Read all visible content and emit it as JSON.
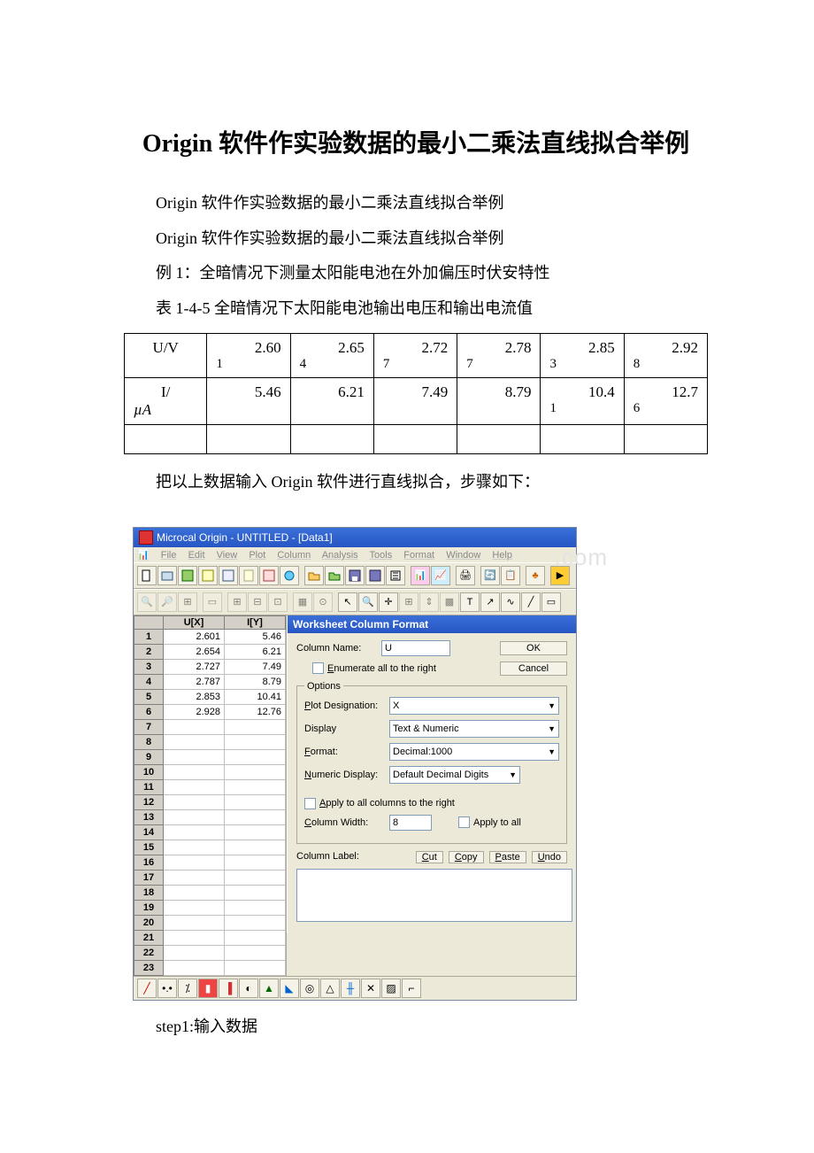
{
  "doc": {
    "title": "Origin 软件作实验数据的最小二乘法直线拟合举例",
    "p1": "Origin 软件作实验数据的最小二乘法直线拟合举例",
    "p2": "Origin 软件作实验数据的最小二乘法直线拟合举例",
    "p3": "例 1：全暗情况下测量太阳能电池在外加偏压时伏安特性",
    "p4": "表 1-4-5 全暗情况下太阳能电池输出电压和输出电流值",
    "p5": "把以上数据输入 Origin 软件进行直线拟合，步骤如下：",
    "p6": "step1:输入数据"
  },
  "table": {
    "row1_head": "U/V",
    "row2_head_html": "I/",
    "row2_head_unit": "µA",
    "cols": [
      {
        "u_top": "2.60",
        "u_bot": "1",
        "i": "5.46",
        "i_bot": ""
      },
      {
        "u_top": "2.65",
        "u_bot": "4",
        "i": "6.21",
        "i_bot": ""
      },
      {
        "u_top": "2.72",
        "u_bot": "7",
        "i": "7.49",
        "i_bot": ""
      },
      {
        "u_top": "2.78",
        "u_bot": "7",
        "i": "8.79",
        "i_bot": ""
      },
      {
        "u_top": "2.85",
        "u_bot": "3",
        "i": "10.4",
        "i_bot": "1"
      },
      {
        "u_top": "2.92",
        "u_bot": "8",
        "i": "12.7",
        "i_bot": "6"
      }
    ]
  },
  "origin": {
    "title": "Microcal Origin - UNTITLED - [Data1]",
    "menu": [
      "File",
      "Edit",
      "View",
      "Plot",
      "Column",
      "Analysis",
      "Tools",
      "Format",
      "Window",
      "Help"
    ],
    "sheet": {
      "headers": [
        "U[X]",
        "I[Y]"
      ],
      "rows": [
        {
          "n": "1",
          "x": "2.601",
          "y": "5.46"
        },
        {
          "n": "2",
          "x": "2.654",
          "y": "6.21"
        },
        {
          "n": "3",
          "x": "2.727",
          "y": "7.49"
        },
        {
          "n": "4",
          "x": "2.787",
          "y": "8.79"
        },
        {
          "n": "5",
          "x": "2.853",
          "y": "10.41"
        },
        {
          "n": "6",
          "x": "2.928",
          "y": "12.76"
        },
        {
          "n": "7",
          "x": "",
          "y": ""
        },
        {
          "n": "8",
          "x": "",
          "y": ""
        },
        {
          "n": "9",
          "x": "",
          "y": ""
        },
        {
          "n": "10",
          "x": "",
          "y": ""
        },
        {
          "n": "11",
          "x": "",
          "y": ""
        },
        {
          "n": "12",
          "x": "",
          "y": ""
        },
        {
          "n": "13",
          "x": "",
          "y": ""
        },
        {
          "n": "14",
          "x": "",
          "y": ""
        },
        {
          "n": "15",
          "x": "",
          "y": ""
        },
        {
          "n": "16",
          "x": "",
          "y": ""
        },
        {
          "n": "17",
          "x": "",
          "y": ""
        },
        {
          "n": "18",
          "x": "",
          "y": ""
        },
        {
          "n": "19",
          "x": "",
          "y": ""
        },
        {
          "n": "20",
          "x": "",
          "y": ""
        },
        {
          "n": "21",
          "x": "",
          "y": ""
        },
        {
          "n": "22",
          "x": "",
          "y": ""
        },
        {
          "n": "23",
          "x": "",
          "y": ""
        }
      ]
    },
    "dialog": {
      "title": "Worksheet Column Format",
      "colname_label": "Column Name:",
      "colname_value": "U",
      "ok": "OK",
      "cancel": "Cancel",
      "enumerate": "Enumerate all to the right",
      "options": "Options",
      "plotdes_label": "Plot Designation:",
      "plotdes_value": "X",
      "display_label": "Display",
      "display_value": "Text & Numeric",
      "format_label": "Format:",
      "format_value": "Decimal:1000",
      "numdisp_label": "Numeric Display:",
      "numdisp_value": "Default Decimal Digits",
      "apply_right": "Apply to all columns to the right",
      "colwidth_label": "Column Width:",
      "colwidth_value": "8",
      "apply_all": "Apply to all",
      "collabel_label": "Column Label:",
      "cut": "Cut",
      "copy": "Copy",
      "paste": "Paste",
      "undo": "Undo"
    }
  }
}
